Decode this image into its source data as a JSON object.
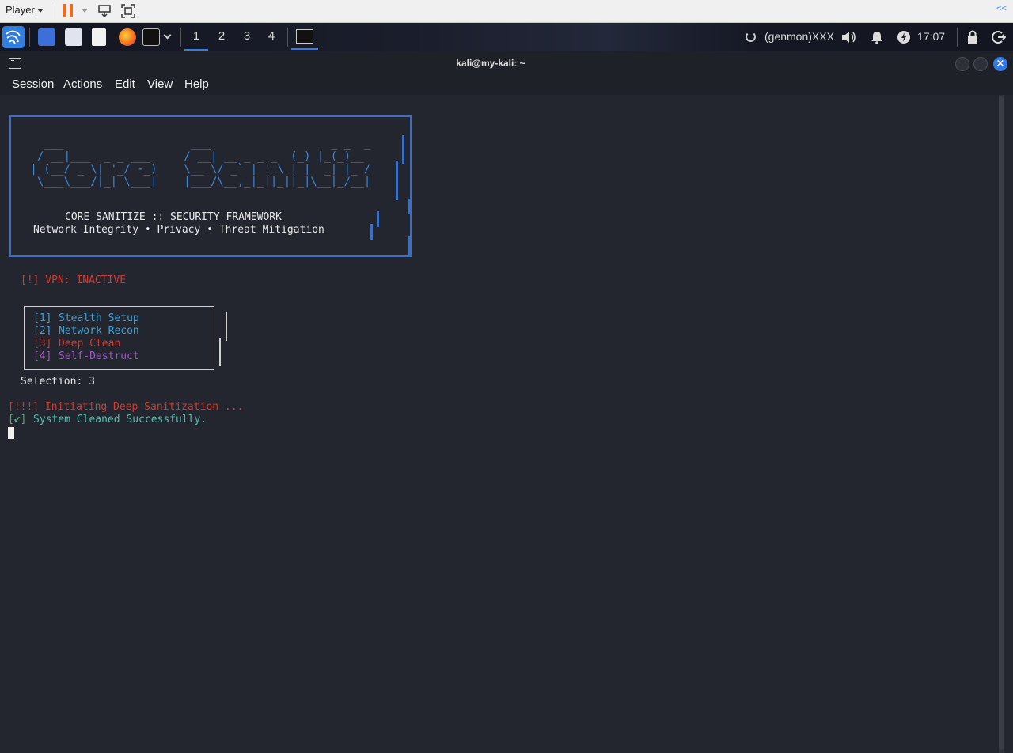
{
  "vmware": {
    "player_label": "Player"
  },
  "panel": {
    "workspaces": [
      "1",
      "2",
      "3",
      "4"
    ],
    "active_workspace": "1",
    "genmon": "(genmon)XXX",
    "clock": "17:07"
  },
  "window": {
    "title": "kali@my-kali: ~",
    "menu": [
      "Session",
      "Actions",
      "Edit",
      "View",
      "Help"
    ]
  },
  "terminal": {
    "ascii_art": [
      "   ___                   ___                  _ _  _",
      "  / __|___  _ _ ___     / __| __ _ _ _  (_) |_(_)__",
      " | (__/ _ \\| '_/ -_)    \\__ \\/ _` | ' \\ | |  _| |_ /",
      "  \\___\\___/|_| \\___|    |___/\\__,_|_||_||_|\\__|_/__|"
    ],
    "banner_title": "CORE SANITIZE :: SECURITY FRAMEWORK",
    "banner_subtitle": "Network Integrity • Privacy • Threat Mitigation",
    "vpn_status": "[!] VPN: INACTIVE",
    "menu_items": [
      {
        "num": "[1]",
        "label": "Stealth Setup",
        "color": "#3fa2d8"
      },
      {
        "num": "[2]",
        "label": "Network Recon",
        "color": "#3fa2d8"
      },
      {
        "num": "[3]",
        "label": "Deep Clean",
        "color": "#d23a32"
      },
      {
        "num": "[4]",
        "label": "Self-Destruct",
        "color": "#a05ac8"
      }
    ],
    "selection": "Selection: 3",
    "status_init": "[!!!] Initiating Deep Sanitization ...",
    "status_done_mark": "[✔]",
    "status_done": "System Cleaned Successfully."
  },
  "colors": {
    "accent": "#3478e5",
    "terminal_bg": "#23262e",
    "banner": "#3e86d6",
    "error": "#d23a32",
    "success": "#49b07d"
  }
}
